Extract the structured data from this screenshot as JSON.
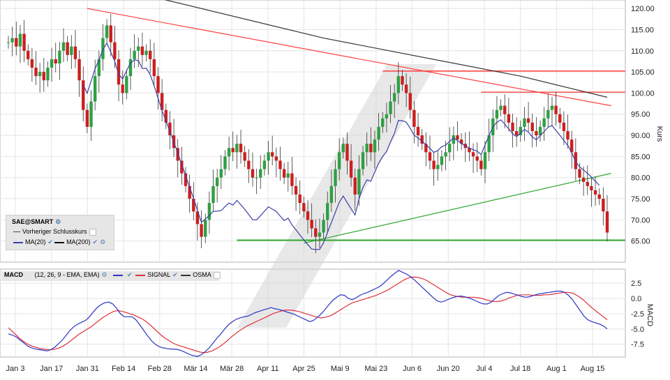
{
  "colors": {
    "up": "#2ea043",
    "down": "#cc1f1f",
    "ma20": "#3b3fa8",
    "ma200": "#333333",
    "resistance": "#ff4040",
    "support": "#2ea82e",
    "signal": "#e0303c",
    "macd": "#2b35c4"
  },
  "price_axis": {
    "label": "Kurs",
    "ticks": [
      "120.00",
      "115.00",
      "110.00",
      "105.00",
      "100.00",
      "95.00",
      "90.00",
      "85.00",
      "80.00",
      "75.00",
      "70.00",
      "65.00"
    ]
  },
  "macd_axis": {
    "label": "MACD",
    "ticks": [
      "2.5",
      "0.0",
      "-2.5",
      "-5.0",
      "-7.5"
    ]
  },
  "x_axis": {
    "ticks": [
      "Jan 3",
      "Jan 17",
      "Jan 31",
      "Feb 14",
      "Feb 28",
      "Mär 14",
      "Mär 28",
      "Apr 11",
      "Apr 25",
      "Mai 9",
      "Mai 23",
      "Jun 6",
      "Jun 20",
      "Jul 4",
      "Jul 18",
      "Aug 1",
      "Aug 15"
    ]
  },
  "legend": {
    "symbol": "SAE@SMART",
    "prev_close": "Vorheriger Schlusskurs",
    "ma20": "MA(20)",
    "ma200": "MA(200)"
  },
  "macd_legend": {
    "title": "MACD",
    "params": "(12, 26, 9 - EMA, EMA)",
    "signal": "SIGNAL",
    "osma": "OSMA"
  },
  "chart_data": {
    "type": "candlestick",
    "xlabel": "",
    "ylabel": "Kurs",
    "ylim": [
      60,
      122
    ],
    "closes": [
      112,
      113,
      111,
      114,
      110,
      108,
      106,
      104,
      105,
      103,
      106,
      108,
      107,
      110,
      112,
      109,
      111,
      108,
      103,
      96,
      92,
      98,
      104,
      108,
      113,
      116,
      112,
      108,
      102,
      100,
      104,
      108,
      110,
      111,
      109,
      110,
      108,
      104,
      100,
      96,
      93,
      90,
      87,
      84,
      81,
      78,
      75,
      72,
      69,
      66,
      70,
      74,
      78,
      80,
      82,
      85,
      87,
      86,
      88,
      86,
      84,
      82,
      80,
      80,
      82,
      84,
      86,
      85,
      84,
      82,
      80,
      81,
      78,
      76,
      74,
      72,
      70,
      68,
      66,
      67,
      70,
      74,
      78,
      82,
      86,
      88,
      84,
      80,
      76,
      82,
      86,
      88,
      86,
      89,
      92,
      94,
      95,
      98,
      100,
      104,
      102,
      100,
      96,
      92,
      90,
      88,
      86,
      84,
      82,
      83,
      85,
      86,
      88,
      90,
      89,
      88,
      87,
      86,
      85,
      84,
      82,
      86,
      90,
      94,
      96,
      97,
      95,
      93,
      91,
      90,
      92,
      94,
      93,
      91,
      90,
      92,
      94,
      96,
      97,
      95,
      93,
      91,
      89,
      86,
      82,
      80,
      79,
      78,
      77,
      76,
      75,
      72,
      67
    ],
    "ma20": [
      null,
      null,
      null,
      null,
      null,
      null,
      null,
      null,
      null,
      null,
      null,
      null,
      null,
      null,
      null,
      null,
      null,
      null,
      null,
      107.9,
      107.9,
      107.6,
      107.5,
      107.6,
      107.6,
      107.6,
      107.3,
      107.0,
      106.8,
      106.7,
      106.5,
      106.2,
      105.7,
      104.3,
      102.6,
      101.7,
      100.7,
      99.3,
      97.5,
      95.7,
      93.9,
      91.9,
      89.8,
      87.6,
      85.3,
      83.0,
      80.6,
      78.1,
      75.5,
      72.8,
      70.4,
      68.1,
      66.0,
      64.1,
      62.4,
      61.3,
      61.0,
      61.0,
      61.2,
      61.2,
      61.0,
      60.6,
      60.1,
      60.0,
      60.0,
      60.1,
      60.2,
      60.1,
      60.0,
      59.8,
      59.7,
      59.8,
      59.6,
      59.3,
      58.9,
      58.5,
      58.3,
      58.2,
      58.3,
      58.6,
      59.2,
      60.0,
      60.8,
      61.6,
      62.4,
      63.3,
      64.2,
      65.2,
      66.3,
      67.8,
      69.4,
      70.9,
      72.3,
      73.6,
      74.8,
      76.0,
      77.3,
      78.9,
      80.9,
      83.0,
      84.9,
      86.2,
      87.3,
      88.1,
      88.7,
      89.2,
      89.6,
      89.9,
      89.9,
      89.8,
      89.6,
      89.4,
      89.1,
      88.8,
      88.5,
      88.2,
      88.0,
      88.0,
      88.2,
      88.5,
      88.9,
      89.4,
      89.8,
      90.0,
      90.2,
      90.3,
      90.3,
      90.1,
      89.7,
      89.4,
      89.1,
      88.8,
      88.5,
      88.2,
      87.9,
      87.8,
      87.8,
      87.8,
      87.6,
      87.3,
      87.0,
      86.6,
      86.2,
      85.9,
      85.5,
      85.1,
      84.6,
      84.0,
      83.2,
      82.3,
      81.3
    ],
    "ma200_points": [
      [
        0,
        130
      ],
      [
        40,
        122
      ],
      [
        80,
        113
      ],
      [
        130,
        104
      ],
      [
        152,
        99
      ]
    ],
    "resistance_line": [
      [
        20,
        120
      ],
      [
        153,
        97
      ]
    ],
    "support_line": [
      [
        75,
        64.5
      ],
      [
        153,
        81
      ]
    ],
    "horizontal_levels": [
      65.2,
      100.2,
      105.2
    ],
    "macd": [
      -5.8,
      -6.0,
      -6.3,
      -6.8,
      -7.3,
      -7.8,
      -8.1,
      -8.3,
      -8.4,
      -8.5,
      -8.6,
      -8.4,
      -8.0,
      -7.4,
      -6.8,
      -6.0,
      -5.2,
      -4.6,
      -4.2,
      -3.9,
      -3.6,
      -3.0,
      -2.2,
      -1.5,
      -1.0,
      -0.7,
      -0.6,
      -0.9,
      -1.6,
      -2.5,
      -3.0,
      -3.0,
      -3.0,
      -3.5,
      -4.3,
      -5.2,
      -6.1,
      -6.9,
      -7.5,
      -7.9,
      -8.1,
      -8.2,
      -8.3,
      -8.3,
      -8.4,
      -8.6,
      -8.9,
      -9.2,
      -9.4,
      -9.5,
      -9.2,
      -8.7,
      -8.1,
      -7.3,
      -6.5,
      -5.8,
      -5.0,
      -4.3,
      -3.8,
      -3.4,
      -3.2,
      -3.0,
      -2.9,
      -2.6,
      -2.3,
      -2.1,
      -1.9,
      -1.7,
      -1.5,
      -1.7,
      -1.8,
      -2.0,
      -2.2,
      -2.4,
      -2.6,
      -2.9,
      -3.2,
      -3.5,
      -3.8,
      -3.6,
      -3.1,
      -2.5,
      -1.8,
      -1.0,
      -0.3,
      0.2,
      0.6,
      0.5,
      0.0,
      -0.2,
      0.1,
      0.5,
      0.8,
      1.0,
      1.3,
      1.6,
      1.9,
      2.4,
      3.0,
      3.6,
      4.1,
      4.6,
      4.3,
      4.0,
      3.6,
      3.1,
      2.5,
      1.9,
      1.3,
      0.7,
      0.1,
      -0.4,
      -0.6,
      -0.4,
      -0.1,
      0.1,
      0.3,
      0.4,
      0.3,
      0.1,
      -0.1,
      -0.4,
      -0.7,
      -0.9,
      -0.9,
      -0.6,
      0.0,
      0.5,
      0.8,
      1.0,
      0.9,
      0.7,
      0.5,
      0.3,
      0.2,
      0.3,
      0.5,
      0.7,
      0.8,
      0.9,
      1.0,
      1.1,
      1.2,
      1.2,
      1.0,
      0.5,
      -0.2,
      -1.1,
      -2.0,
      -2.9,
      -3.5,
      -3.8,
      -4.0,
      -4.2,
      -4.5,
      -5.0
    ],
    "signal": [
      -4.8,
      -5.4,
      -6.0,
      -6.6,
      -7.1,
      -7.5,
      -7.8,
      -8.0,
      -8.2,
      -8.3,
      -8.4,
      -8.4,
      -8.3,
      -8.1,
      -7.8,
      -7.4,
      -6.9,
      -6.4,
      -5.9,
      -5.5,
      -5.1,
      -4.7,
      -4.2,
      -3.7,
      -3.2,
      -2.8,
      -2.4,
      -2.1,
      -2.0,
      -2.1,
      -2.3,
      -2.5,
      -2.7,
      -3.0,
      -3.3,
      -3.7,
      -4.2,
      -4.8,
      -5.4,
      -6.0,
      -6.5,
      -6.9,
      -7.3,
      -7.6,
      -7.8,
      -8.0,
      -8.2,
      -8.4,
      -8.6,
      -8.8,
      -8.9,
      -8.8,
      -8.6,
      -8.3,
      -7.9,
      -7.4,
      -6.9,
      -6.3,
      -5.8,
      -5.3,
      -4.9,
      -4.5,
      -4.2,
      -3.9,
      -3.6,
      -3.3,
      -3.0,
      -2.7,
      -2.4,
      -2.2,
      -2.0,
      -1.9,
      -1.9,
      -2.0,
      -2.1,
      -2.3,
      -2.5,
      -2.7,
      -2.9,
      -3.1,
      -3.2,
      -3.1,
      -2.9,
      -2.6,
      -2.2,
      -1.8,
      -1.4,
      -1.0,
      -0.7,
      -0.5,
      -0.3,
      -0.1,
      0.1,
      0.3,
      0.5,
      0.8,
      1.1,
      1.4,
      1.8,
      2.2,
      2.6,
      3.0,
      3.3,
      3.5,
      3.5,
      3.4,
      3.2,
      2.9,
      2.5,
      2.1,
      1.7,
      1.3,
      0.9,
      0.6,
      0.4,
      0.3,
      0.2,
      0.2,
      0.2,
      0.2,
      0.1,
      0.0,
      -0.2,
      -0.4,
      -0.5,
      -0.5,
      -0.4,
      -0.2,
      0.1,
      0.3,
      0.5,
      0.6,
      0.6,
      0.6,
      0.5,
      0.5,
      0.5,
      0.6,
      0.6,
      0.7,
      0.8,
      0.9,
      1.0,
      1.0,
      0.9,
      0.6,
      0.2,
      -0.3,
      -0.9,
      -1.5,
      -2.0,
      -2.5,
      -3.0,
      -3.5
    ]
  }
}
